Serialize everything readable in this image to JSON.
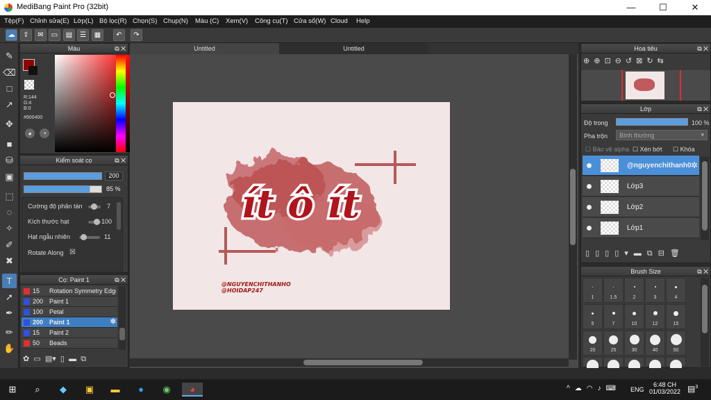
{
  "window": {
    "title": "MediBang Paint Pro (32bit)",
    "min": "—",
    "max": "☐",
    "close": "✕"
  },
  "menu": [
    "Tệp(F)",
    "Chỉnh sửa(E)",
    "Lớp(L)",
    "Bộ lọc(R)",
    "Chọn(S)",
    "Chụp(N)",
    "Màu (C)",
    "Xem(V)",
    "Công cụ(T)",
    "Cửa sổ(W)",
    "Cloud",
    "Help"
  ],
  "color_panel": {
    "title": "Màu",
    "r": "R:144",
    "g": "G:4",
    "b": "B:0",
    "hex": "#900400",
    "fg_color": "#900400"
  },
  "brush_control": {
    "title": "Kiểm soát cọ",
    "size_value": "200",
    "opacity_value": "85 %",
    "rows": [
      {
        "label": "Cường độ phân tán",
        "value": "7"
      },
      {
        "label": "Kích thước hạt",
        "value": "100"
      },
      {
        "label": "Hạt ngẫu nhiên",
        "value": "11"
      },
      {
        "label": "Rotate Along",
        "value": "☒"
      }
    ]
  },
  "brush_list": {
    "title": "Cọ: Paint 1",
    "items": [
      {
        "size": "15",
        "name": "Rotation Symmetry Edge",
        "color": "#e03030"
      },
      {
        "size": "200",
        "name": "Paint 1",
        "color": "#3050e0"
      },
      {
        "size": "100",
        "name": "Petal",
        "color": "#3050e0"
      },
      {
        "size": "200",
        "name": "Paint 1",
        "color": "#3050e0"
      },
      {
        "size": "15",
        "name": "Paint 2",
        "color": "#3050e0"
      },
      {
        "size": "50",
        "name": "Beads",
        "color": "#e03030"
      }
    ]
  },
  "tabs": [
    "Untitled",
    "Untitled"
  ],
  "artwork": {
    "main_text": "ít ô ít",
    "credit_1": "@NGUYENCHITHANHO",
    "credit_2": "@HOIDAP247"
  },
  "navigator": {
    "title": "Hoa tiêu"
  },
  "layers": {
    "title": "Lớp",
    "opacity_label": "Độ trong",
    "opacity_value": "100 %",
    "blend_label": "Pha trộn",
    "blend_value": "Bình thường",
    "protect_alpha": "Bảo vệ alpha",
    "clipping": "Xén bớt",
    "lock": "Khóa",
    "items": [
      {
        "name": "@nguyenchithanh0",
        "selected": true
      },
      {
        "name": "Lớp3",
        "selected": false
      },
      {
        "name": "Lớp2",
        "selected": false
      },
      {
        "name": "Lớp1",
        "selected": false
      }
    ]
  },
  "brush_size": {
    "title": "Brush Size",
    "rows": [
      [
        "1",
        "1.5",
        "2",
        "3",
        "4"
      ],
      [
        "5",
        "7",
        "10",
        "12",
        "15"
      ],
      [
        "20",
        "25",
        "30",
        "40",
        "50"
      ]
    ]
  },
  "taskbar": {
    "time": "6:48 CH",
    "date": "01/03/2022",
    "lang": "ENG",
    "notif": "3"
  }
}
